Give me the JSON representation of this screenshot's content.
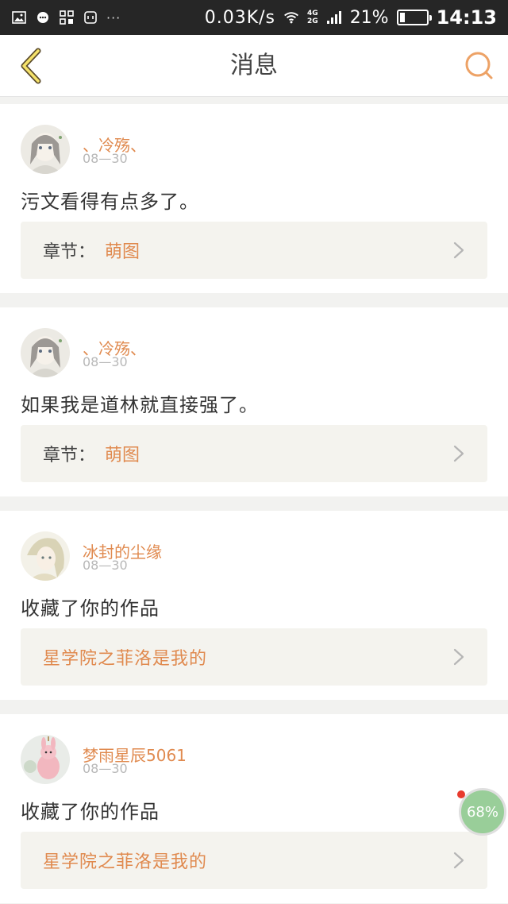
{
  "status_bar": {
    "net_speed": "0.03K/s",
    "net_type_top": "4G",
    "net_type_bottom": "2G",
    "battery_percent": "21%",
    "battery_level": 0.21,
    "time": "14:13",
    "notif_overflow": "···"
  },
  "header": {
    "title": "消息"
  },
  "messages": [
    {
      "username": "、冷殇、",
      "time": "08—30",
      "text": "污文看得有点多了。",
      "ref_label": "章节：",
      "ref_value": "萌图"
    },
    {
      "username": "、冷殇、",
      "time": "08—30",
      "text": "如果我是道林就直接强了。",
      "ref_label": "章节：",
      "ref_value": "萌图"
    },
    {
      "username": "冰封的尘缘",
      "time": "08—30",
      "text": "收藏了你的作品",
      "ref_title": "星学院之菲洛是我的"
    },
    {
      "username": "梦雨星辰5061",
      "time": "08—30",
      "text": "收藏了你的作品",
      "ref_title": "星学院之菲洛是我的"
    }
  ],
  "float_widget": {
    "label": "68%"
  },
  "colors": {
    "accent": "#e08a4f",
    "status_bar_bg": "#262626",
    "ref_box_bg": "#f4f3ee",
    "page_bg": "#f2f2f0"
  }
}
